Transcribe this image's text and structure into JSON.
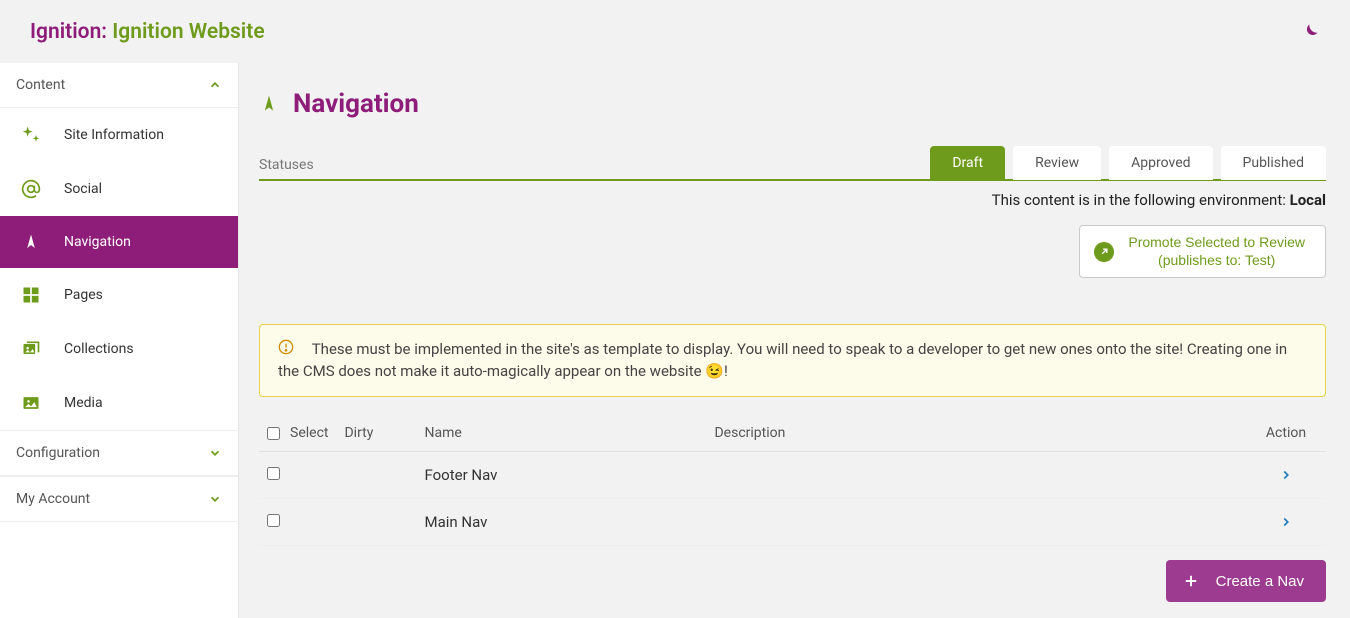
{
  "header": {
    "brand_prefix": "Ignition:",
    "brand_suffix": "Ignition Website"
  },
  "sidebar": {
    "sections": {
      "content": {
        "label": "Content"
      },
      "configuration": {
        "label": "Configuration"
      },
      "my_account": {
        "label": "My Account"
      }
    },
    "items": [
      {
        "label": "Site Information",
        "icon": "sparkles-icon"
      },
      {
        "label": "Social",
        "icon": "at-icon"
      },
      {
        "label": "Navigation",
        "icon": "compass-icon"
      },
      {
        "label": "Pages",
        "icon": "grid-icon"
      },
      {
        "label": "Collections",
        "icon": "image-stack-icon"
      },
      {
        "label": "Media",
        "icon": "image-icon"
      }
    ]
  },
  "page": {
    "title": "Navigation",
    "statuses_label": "Statuses",
    "status_tabs": [
      "Draft",
      "Review",
      "Approved",
      "Published"
    ],
    "active_status_index": 0,
    "env_prefix": "This content is in the following environment: ",
    "env_value": "Local",
    "promote_line1": "Promote Selected to Review",
    "promote_line2": "(publishes to: Test)",
    "alert": "These must be implemented in the site's as template to display. You will need to speak to a developer to get new ones onto the site! Creating one in the CMS does not make it auto-magically appear on the website 😉!",
    "table": {
      "headers": {
        "select": "Select",
        "dirty": "Dirty",
        "name": "Name",
        "description": "Description",
        "action": "Action"
      },
      "rows": [
        {
          "name": "Footer Nav",
          "description": ""
        },
        {
          "name": "Main Nav",
          "description": ""
        }
      ]
    },
    "create_label": "Create a Nav"
  }
}
